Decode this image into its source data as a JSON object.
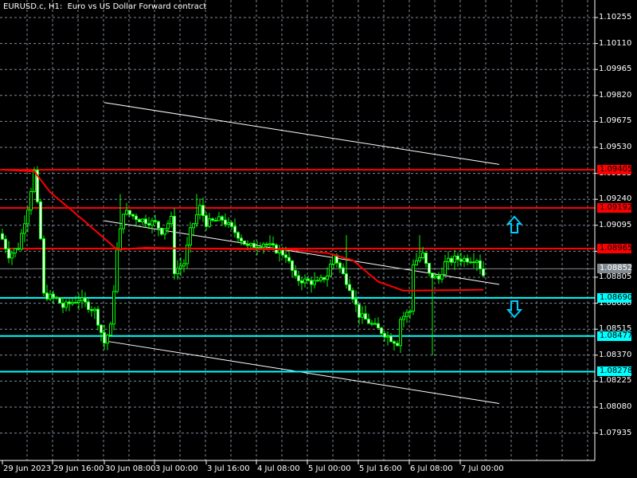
{
  "title": "EURUSD.c, H1:  Euro vs US Dollar Forward contract",
  "colors": {
    "background": "#000000",
    "grid": "#7f8a99",
    "bull": "#00ff00",
    "bear_body": "#ffffff",
    "ma": "#ff0000",
    "resistance": "#ff0000",
    "support": "#00ffff",
    "current": "#808890",
    "trendline": "#ffffff"
  },
  "price_axis": [
    "1.10255",
    "1.10110",
    "1.09965",
    "1.09820",
    "1.09675",
    "1.09530",
    "1.09385",
    "1.09240",
    "1.09095",
    "1.08950",
    "1.08805",
    "1.08660",
    "1.08515",
    "1.08370",
    "1.08225",
    "1.08080",
    "1.07935"
  ],
  "time_axis": [
    "29 Jun 2023",
    "29 Jun 16:00",
    "30 Jun 08:00",
    "3 Jul 00:00",
    "3 Jul 16:00",
    "4 Jul 08:00",
    "5 Jul 00:00",
    "5 Jul 16:00",
    "6 Jul 08:00",
    "7 Jul 00:00"
  ],
  "levels": [
    {
      "price": "1.09405",
      "type": "resistance"
    },
    {
      "price": "1.09192",
      "type": "resistance"
    },
    {
      "price": "1.08965",
      "type": "resistance"
    },
    {
      "price": "1.08852",
      "type": "current"
    },
    {
      "price": "1.08690",
      "type": "support"
    },
    {
      "price": "1.08477",
      "type": "support"
    },
    {
      "price": "1.08278",
      "type": "support"
    }
  ],
  "signals": [
    {
      "icon": "arrow-up-icon",
      "direction": "buy"
    },
    {
      "icon": "arrow-down-icon",
      "direction": "sell"
    }
  ],
  "chart_data": {
    "type": "candlestick",
    "symbol": "EURUSD.c",
    "timeframe": "H1",
    "bars": 152,
    "close_keypoints": [
      [
        0,
        1.09018
      ],
      [
        2,
        1.08929
      ],
      [
        5,
        1.08973
      ],
      [
        8,
        1.09196
      ],
      [
        10,
        1.09396
      ],
      [
        12,
        1.09018
      ],
      [
        13,
        1.08706
      ],
      [
        17,
        1.08684
      ],
      [
        19,
        1.0864
      ],
      [
        24,
        1.08684
      ],
      [
        29,
        1.08617
      ],
      [
        32,
        1.08439
      ],
      [
        34,
        1.08528
      ],
      [
        36,
        1.08951
      ],
      [
        38,
        1.09174
      ],
      [
        43,
        1.09129
      ],
      [
        48,
        1.09107
      ],
      [
        50,
        1.09062
      ],
      [
        53,
        1.09129
      ],
      [
        54,
        1.0884
      ],
      [
        57,
        1.08884
      ],
      [
        59,
        1.09062
      ],
      [
        62,
        1.09196
      ],
      [
        64,
        1.09107
      ],
      [
        69,
        1.09129
      ],
      [
        74,
        1.0904
      ],
      [
        77,
        1.08973
      ],
      [
        82,
        1.08996
      ],
      [
        89,
        1.08929
      ],
      [
        92,
        1.08795
      ],
      [
        99,
        1.08773
      ],
      [
        102,
        1.08818
      ],
      [
        104,
        1.08929
      ],
      [
        107,
        1.08818
      ],
      [
        109,
        1.08751
      ],
      [
        112,
        1.08595
      ],
      [
        117,
        1.08528
      ],
      [
        122,
        1.08462
      ],
      [
        124,
        1.08439
      ],
      [
        125,
        1.08573
      ],
      [
        128,
        1.08617
      ],
      [
        129,
        1.08884
      ],
      [
        132,
        1.08929
      ],
      [
        134,
        1.08818
      ],
      [
        137,
        1.08795
      ],
      [
        139,
        1.08884
      ],
      [
        142,
        1.08907
      ],
      [
        149,
        1.08907
      ],
      [
        151,
        1.08818
      ]
    ],
    "spikes": [
      [
        10,
        "high",
        1.0942
      ],
      [
        37,
        "high",
        1.0927
      ],
      [
        61,
        "high",
        1.0927
      ],
      [
        108,
        "high",
        1.0904
      ],
      [
        131,
        "high",
        1.0904
      ],
      [
        135,
        "low",
        1.0837
      ],
      [
        123,
        "low",
        1.08395
      ],
      [
        32,
        "low",
        1.084
      ]
    ],
    "moving_average": [
      [
        0,
        1.09405
      ],
      [
        10,
        1.09396
      ],
      [
        15,
        1.0928
      ],
      [
        25,
        1.0913
      ],
      [
        36,
        1.0896
      ],
      [
        45,
        1.0897
      ],
      [
        60,
        1.08965
      ],
      [
        90,
        1.0896
      ],
      [
        102,
        1.0894
      ],
      [
        110,
        1.089
      ],
      [
        118,
        1.0878
      ],
      [
        126,
        1.0873
      ],
      [
        151,
        1.08735
      ]
    ],
    "channel_lines": [
      [
        [
          32,
          1.0978
        ],
        [
          156,
          1.09435
        ]
      ],
      [
        [
          32,
          1.0912
        ],
        [
          156,
          1.08765
        ]
      ],
      [
        [
          32,
          1.0845
        ],
        [
          156,
          1.081
        ]
      ]
    ]
  }
}
